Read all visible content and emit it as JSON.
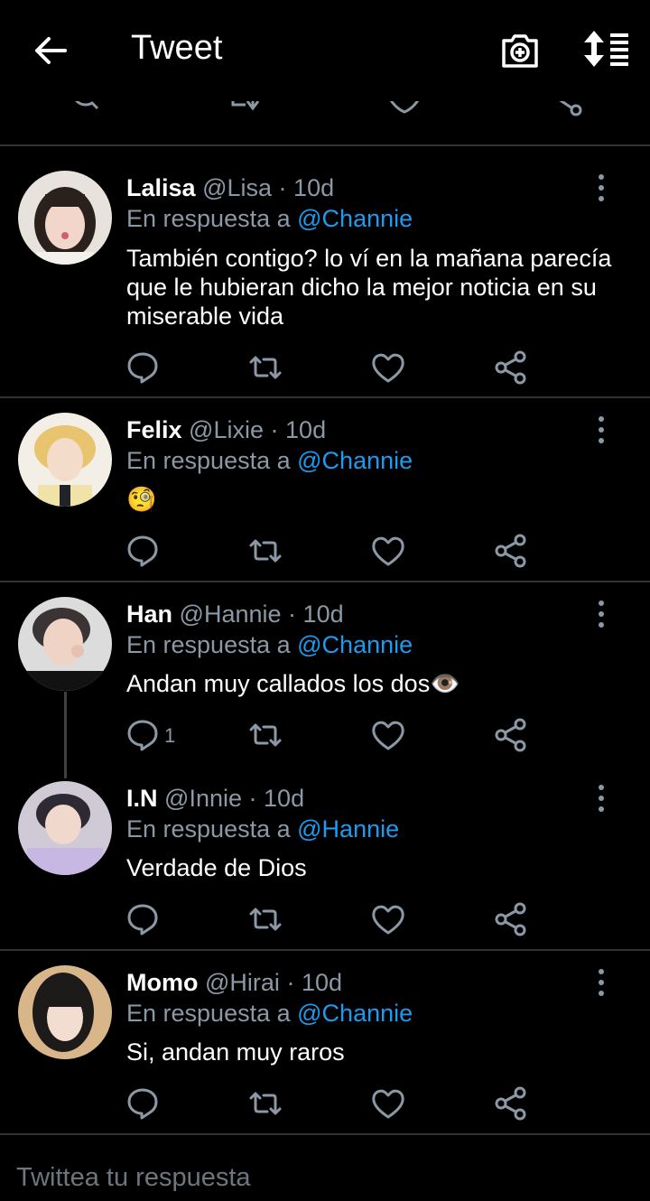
{
  "header": {
    "title": "Tweet",
    "icons": [
      "arrow-left-icon",
      "camera-plus-icon",
      "sort-icon"
    ]
  },
  "colors": {
    "background": "#000000",
    "accent": "#1d9bf0",
    "muted": "#8b98a5",
    "divider": "#2f3336"
  },
  "tweets": [
    {
      "name": "Lalisa",
      "handle": "@Lisa",
      "dot": "·",
      "time": "10d",
      "reply_prefix": "En respuesta a",
      "reply_to": "@Channie",
      "text": "También contigo? lo ví en la mañana parecía que le hubieran dicho la mejor noticia en su miserable vida",
      "reply_count": ""
    },
    {
      "name": "Felix",
      "handle": "@Lixie",
      "dot": "·",
      "time": "10d",
      "reply_prefix": "En respuesta a",
      "reply_to": "@Channie",
      "text": "🧐",
      "reply_count": ""
    },
    {
      "name": "Han",
      "handle": "@Hannie",
      "dot": "·",
      "time": "10d",
      "reply_prefix": "En respuesta a",
      "reply_to": "@Channie",
      "text": "Andan muy callados los dos👁️",
      "reply_count": "1"
    },
    {
      "name": "I.N",
      "handle": "@Innie",
      "dot": "·",
      "time": "10d",
      "reply_prefix": "En respuesta a",
      "reply_to": "@Hannie",
      "text": "Verdade de Dios",
      "reply_count": ""
    },
    {
      "name": "Momo",
      "handle": "@Hirai",
      "dot": "·",
      "time": "10d",
      "reply_prefix": "En respuesta a",
      "reply_to": "@Channie",
      "text": "Si, andan muy raros",
      "reply_count": ""
    }
  ],
  "reply_bar": {
    "placeholder": "Twittea tu respuesta"
  }
}
